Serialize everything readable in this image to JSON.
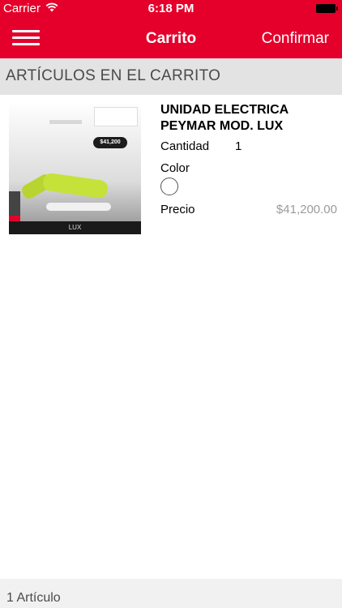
{
  "status_bar": {
    "carrier": "Carrier",
    "time": "6:18 PM"
  },
  "header": {
    "title": "Carrito",
    "confirm_label": "Confirmar",
    "color": "#e4002b"
  },
  "section": {
    "title": "ARTÍCULOS EN EL CARRITO"
  },
  "cart": {
    "items": [
      {
        "name": "UNIDAD ELECTRICA PEYMAR MOD. LUX",
        "quantity_label": "Cantidad",
        "quantity": "1",
        "color_label": "Color",
        "color_value": "#ffffff",
        "price_label": "Precio",
        "price": "$41,200.00",
        "image": {
          "badge_price": "$41,200",
          "caption": "LUX"
        }
      }
    ]
  },
  "footer": {
    "count_label": "1 Artículo"
  },
  "icons": {
    "menu": "hamburger-menu-icon",
    "wifi": "wifi-icon",
    "battery": "battery-icon"
  }
}
